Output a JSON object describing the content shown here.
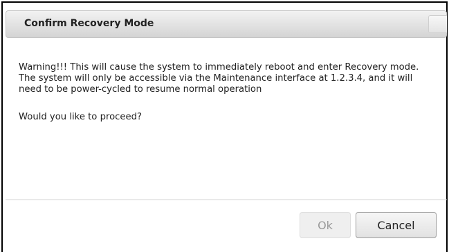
{
  "dialog": {
    "title": "Confirm Recovery Mode",
    "message": "Warning!!! This will cause the system to immediately reboot and enter Recovery mode. The system will only be accessible via the Maintenance interface at 1.2.3.4, and it will need to be power-cycled to resume normal operation",
    "question": "Would you like to proceed?",
    "close_icon": "close-icon",
    "buttons": {
      "ok_label": "Ok",
      "ok_state": "disabled",
      "cancel_label": "Cancel"
    }
  }
}
